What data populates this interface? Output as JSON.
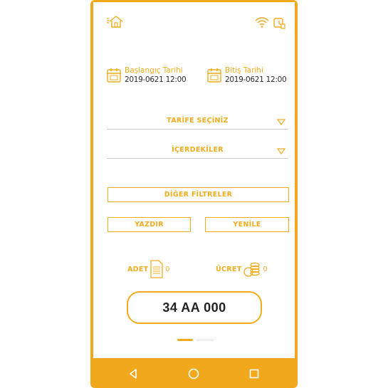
{
  "status_bar": {
    "home_icon": "home-icon",
    "wifi_icon": "wifi-icon",
    "screen_icon": "screen-icon"
  },
  "dates": {
    "start": {
      "label": "Başlangıç Tarihi",
      "value": "2019-0621 12:00",
      "icon": "calendar-icon"
    },
    "end": {
      "label": "Bitiş Tarihi",
      "value": "2019-0621 12:00",
      "icon": "calendar-icon"
    }
  },
  "dropdowns": {
    "tariff": {
      "label": "TARİFE SEÇİNİZ",
      "icon": "triangle-down-icon"
    },
    "contents": {
      "label": "İÇERDEKİLER",
      "icon": "triangle-down-icon"
    }
  },
  "buttons": {
    "other_filters": "DİĞER FİLTRELER",
    "print": "YAZDIR",
    "refresh": "YENİLE"
  },
  "stats": {
    "count": {
      "label": "ADET",
      "value": "0",
      "icon": "document-icon"
    },
    "fee": {
      "label": "ÜCRET",
      "value": "0",
      "icon": "coins-icon"
    }
  },
  "plate": {
    "value": "34 AA 000"
  },
  "pager": {
    "total_pages": 2,
    "current_page": 1
  },
  "navigation": {
    "back": "back-icon",
    "home": "home-circle-icon",
    "recents": "recents-icon"
  },
  "colors": {
    "accent": "#f2a81d",
    "text_dark": "#222222",
    "divider": "#cccccc",
    "background": "#ffffff"
  }
}
